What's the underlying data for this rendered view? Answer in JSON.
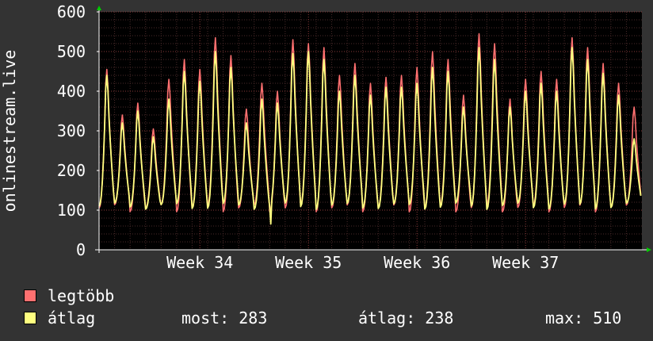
{
  "chart_data": {
    "type": "line",
    "ylabel": "onlinestream.live",
    "ylim": [
      0,
      600
    ],
    "yticks": [
      0,
      100,
      200,
      300,
      400,
      500,
      600
    ],
    "xlim": [
      0,
      35
    ],
    "xticks": [
      {
        "label": "Week 34",
        "x": 6.5
      },
      {
        "label": "Week 35",
        "x": 13.5
      },
      {
        "label": "Week 36",
        "x": 20.5
      },
      {
        "label": "Week 37",
        "x": 27.5
      }
    ],
    "grid": true,
    "background": "#000000",
    "series": [
      {
        "name": "legtöbb",
        "color": "#ff7070",
        "values": [
          455,
          340,
          370,
          305,
          430,
          480,
          455,
          535,
          490,
          355,
          420,
          400,
          530,
          520,
          510,
          440,
          470,
          420,
          435,
          440,
          460,
          500,
          480,
          390,
          545,
          520,
          380,
          430,
          450,
          430,
          535,
          510,
          470,
          420,
          360
        ]
      },
      {
        "name": "átlag",
        "color": "#ffff80",
        "values": [
          440,
          320,
          350,
          285,
          380,
          450,
          425,
          500,
          460,
          320,
          380,
          370,
          495,
          500,
          480,
          400,
          440,
          390,
          410,
          410,
          420,
          460,
          450,
          360,
          510,
          480,
          360,
          400,
          420,
          400,
          510,
          480,
          445,
          390,
          280
        ]
      }
    ]
  },
  "legend": {
    "max_label": "legtöbb",
    "avg_label": "átlag",
    "now_text": "most: 283",
    "avg_text": "átlag: 238",
    "max_text": "max: 510"
  }
}
